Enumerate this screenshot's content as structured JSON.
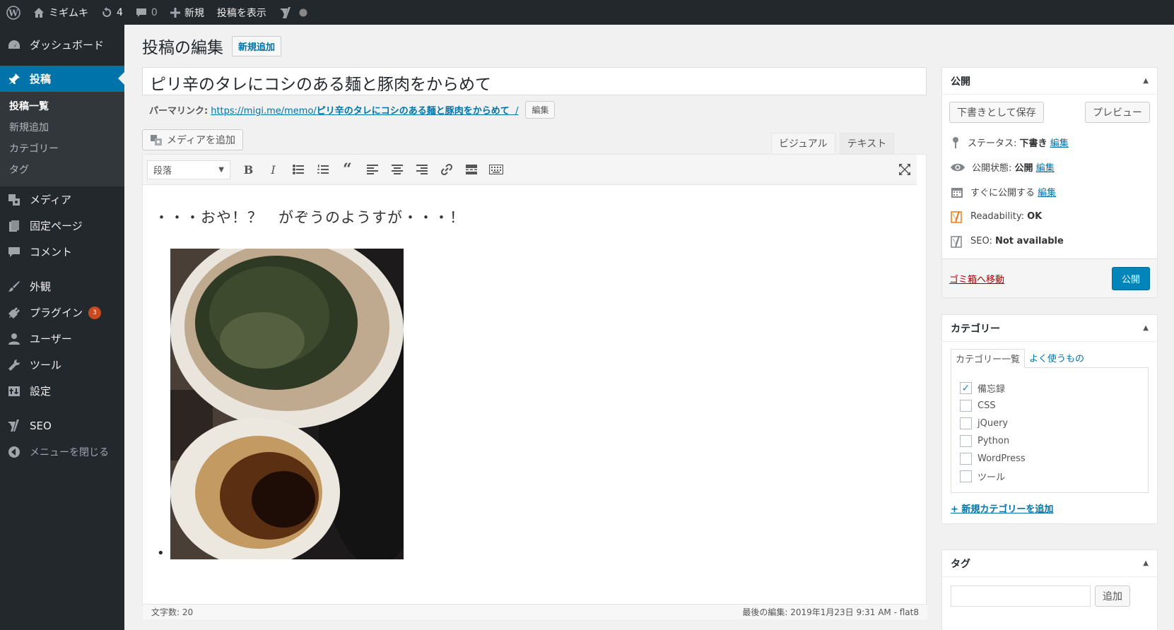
{
  "adminbar": {
    "site_name": "ミギムキ",
    "updates_count": "4",
    "comments_count": "0",
    "new_label": "新規",
    "view_post_label": "投稿を表示"
  },
  "sidebar": {
    "items": [
      {
        "label": "ダッシュボード",
        "icon": "dashboard-icon"
      },
      {
        "label": "投稿",
        "icon": "pin-icon"
      },
      {
        "label": "メディア",
        "icon": "media-icon"
      },
      {
        "label": "固定ページ",
        "icon": "page-icon"
      },
      {
        "label": "コメント",
        "icon": "comment-icon"
      },
      {
        "label": "外観",
        "icon": "brush-icon"
      },
      {
        "label": "プラグイン",
        "icon": "plugin-icon",
        "badge": "3"
      },
      {
        "label": "ユーザー",
        "icon": "user-icon"
      },
      {
        "label": "ツール",
        "icon": "wrench-icon"
      },
      {
        "label": "設定",
        "icon": "settings-icon"
      },
      {
        "label": "SEO",
        "icon": "yoast-icon"
      },
      {
        "label": "メニューを閉じる",
        "icon": "collapse-icon"
      }
    ],
    "submenu": [
      "投稿一覧",
      "新規追加",
      "カテゴリー",
      "タグ"
    ]
  },
  "page": {
    "title": "投稿の編集",
    "add_new": "新規追加"
  },
  "post": {
    "title": "ピリ辛のタレにコシのある麺と豚肉をからめて",
    "permalink_label": "パーマリンク:",
    "permalink_base": "https://migi.me/memo/",
    "permalink_slug": "ピリ辛のタレにコシのある麺と豚肉をからめて",
    "permalink_tail": "/",
    "edit_btn": "編集"
  },
  "editor": {
    "add_media": "メディアを追加",
    "tab_visual": "ビジュアル",
    "tab_text": "テキスト",
    "format": "段落",
    "body_text": "・・・おや！？　がぞうのようすが・・・！",
    "word_count": "文字数: 20",
    "last_edit": "最後の編集: 2019年1月23日 9:31 AM - flat8"
  },
  "publish": {
    "heading": "公開",
    "save_draft": "下書きとして保存",
    "preview": "プレビュー",
    "status_label": "ステータス:",
    "status_value": "下書き",
    "visibility_label": "公開状態:",
    "visibility_value": "公開",
    "schedule_label": "すぐに公開する",
    "edit_link": "編集",
    "readability_label": "Readability:",
    "readability_value": "OK",
    "seo_label": "SEO:",
    "seo_value": "Not available",
    "trash": "ゴミ箱へ移動",
    "publish_btn": "公開"
  },
  "categories": {
    "heading": "カテゴリー",
    "tab_all": "カテゴリー一覧",
    "tab_popular": "よく使うもの",
    "items": [
      {
        "label": "備忘録",
        "checked": true
      },
      {
        "label": "CSS",
        "checked": false
      },
      {
        "label": "jQuery",
        "checked": false
      },
      {
        "label": "Python",
        "checked": false
      },
      {
        "label": "WordPress",
        "checked": false
      },
      {
        "label": "ツール",
        "checked": false
      }
    ],
    "add_new": "+ 新規カテゴリーを追加"
  },
  "tags": {
    "heading": "タグ",
    "add_btn": "追加"
  },
  "colors": {
    "accent": "#0073aa",
    "adminbar": "#23282d",
    "publish_button": "#0085ba"
  }
}
